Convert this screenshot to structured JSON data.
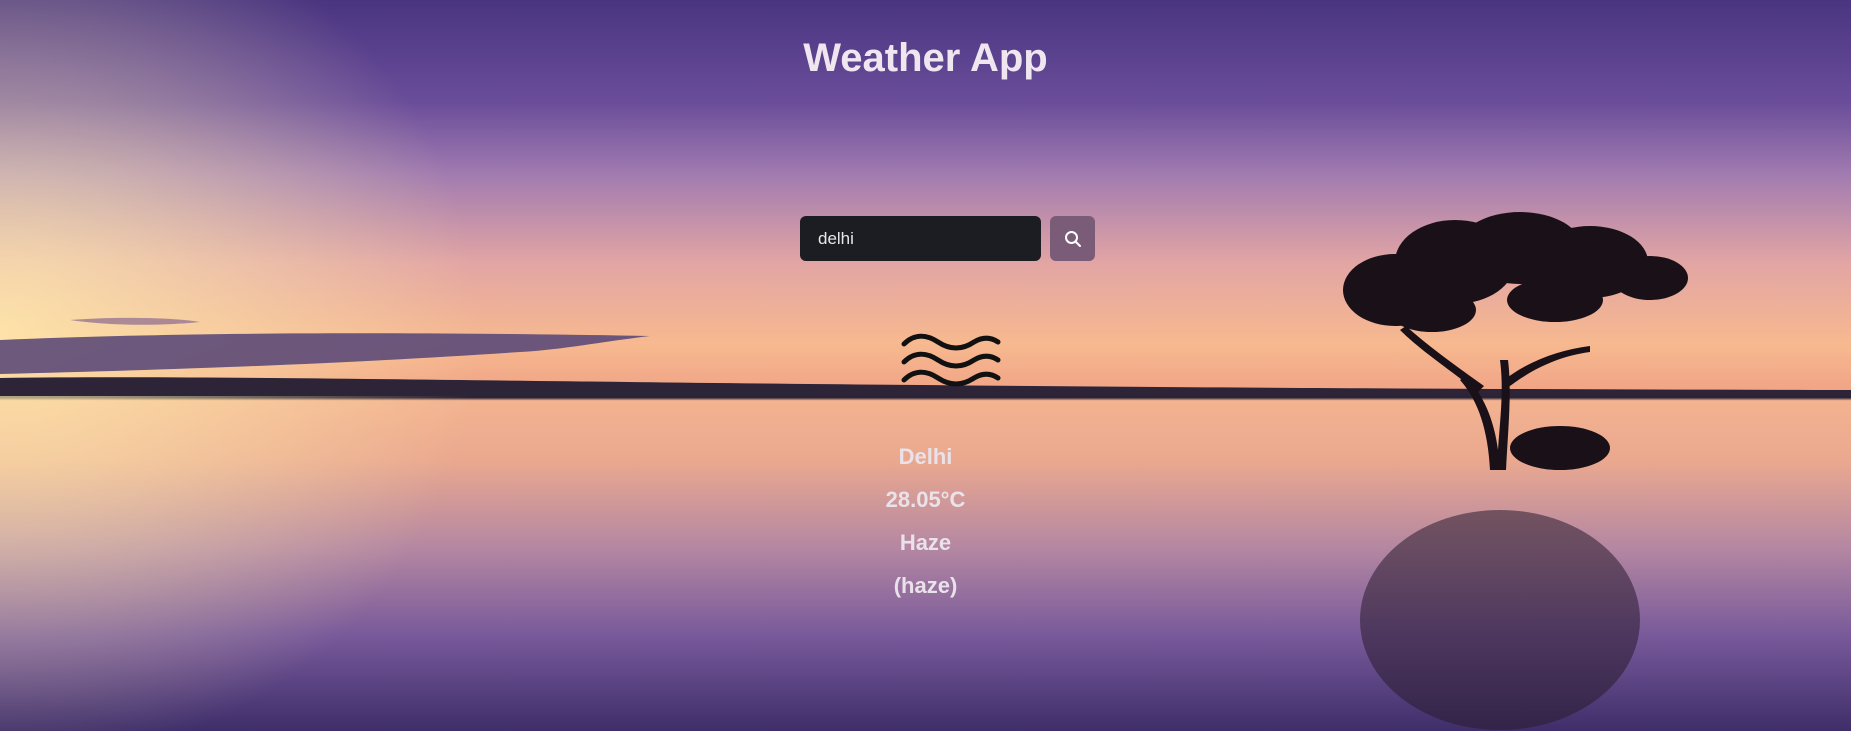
{
  "header": {
    "title": "Weather App"
  },
  "search": {
    "value": "delhi",
    "button_icon": "search-icon"
  },
  "weather": {
    "icon": "haze-icon",
    "city": "Delhi",
    "temperature": "28.05°C",
    "condition": "Haze",
    "description": "(haze)"
  },
  "colors": {
    "input_bg": "#1c1d22",
    "button_bg": "#7b5c78",
    "text": "#e9e2ea"
  }
}
